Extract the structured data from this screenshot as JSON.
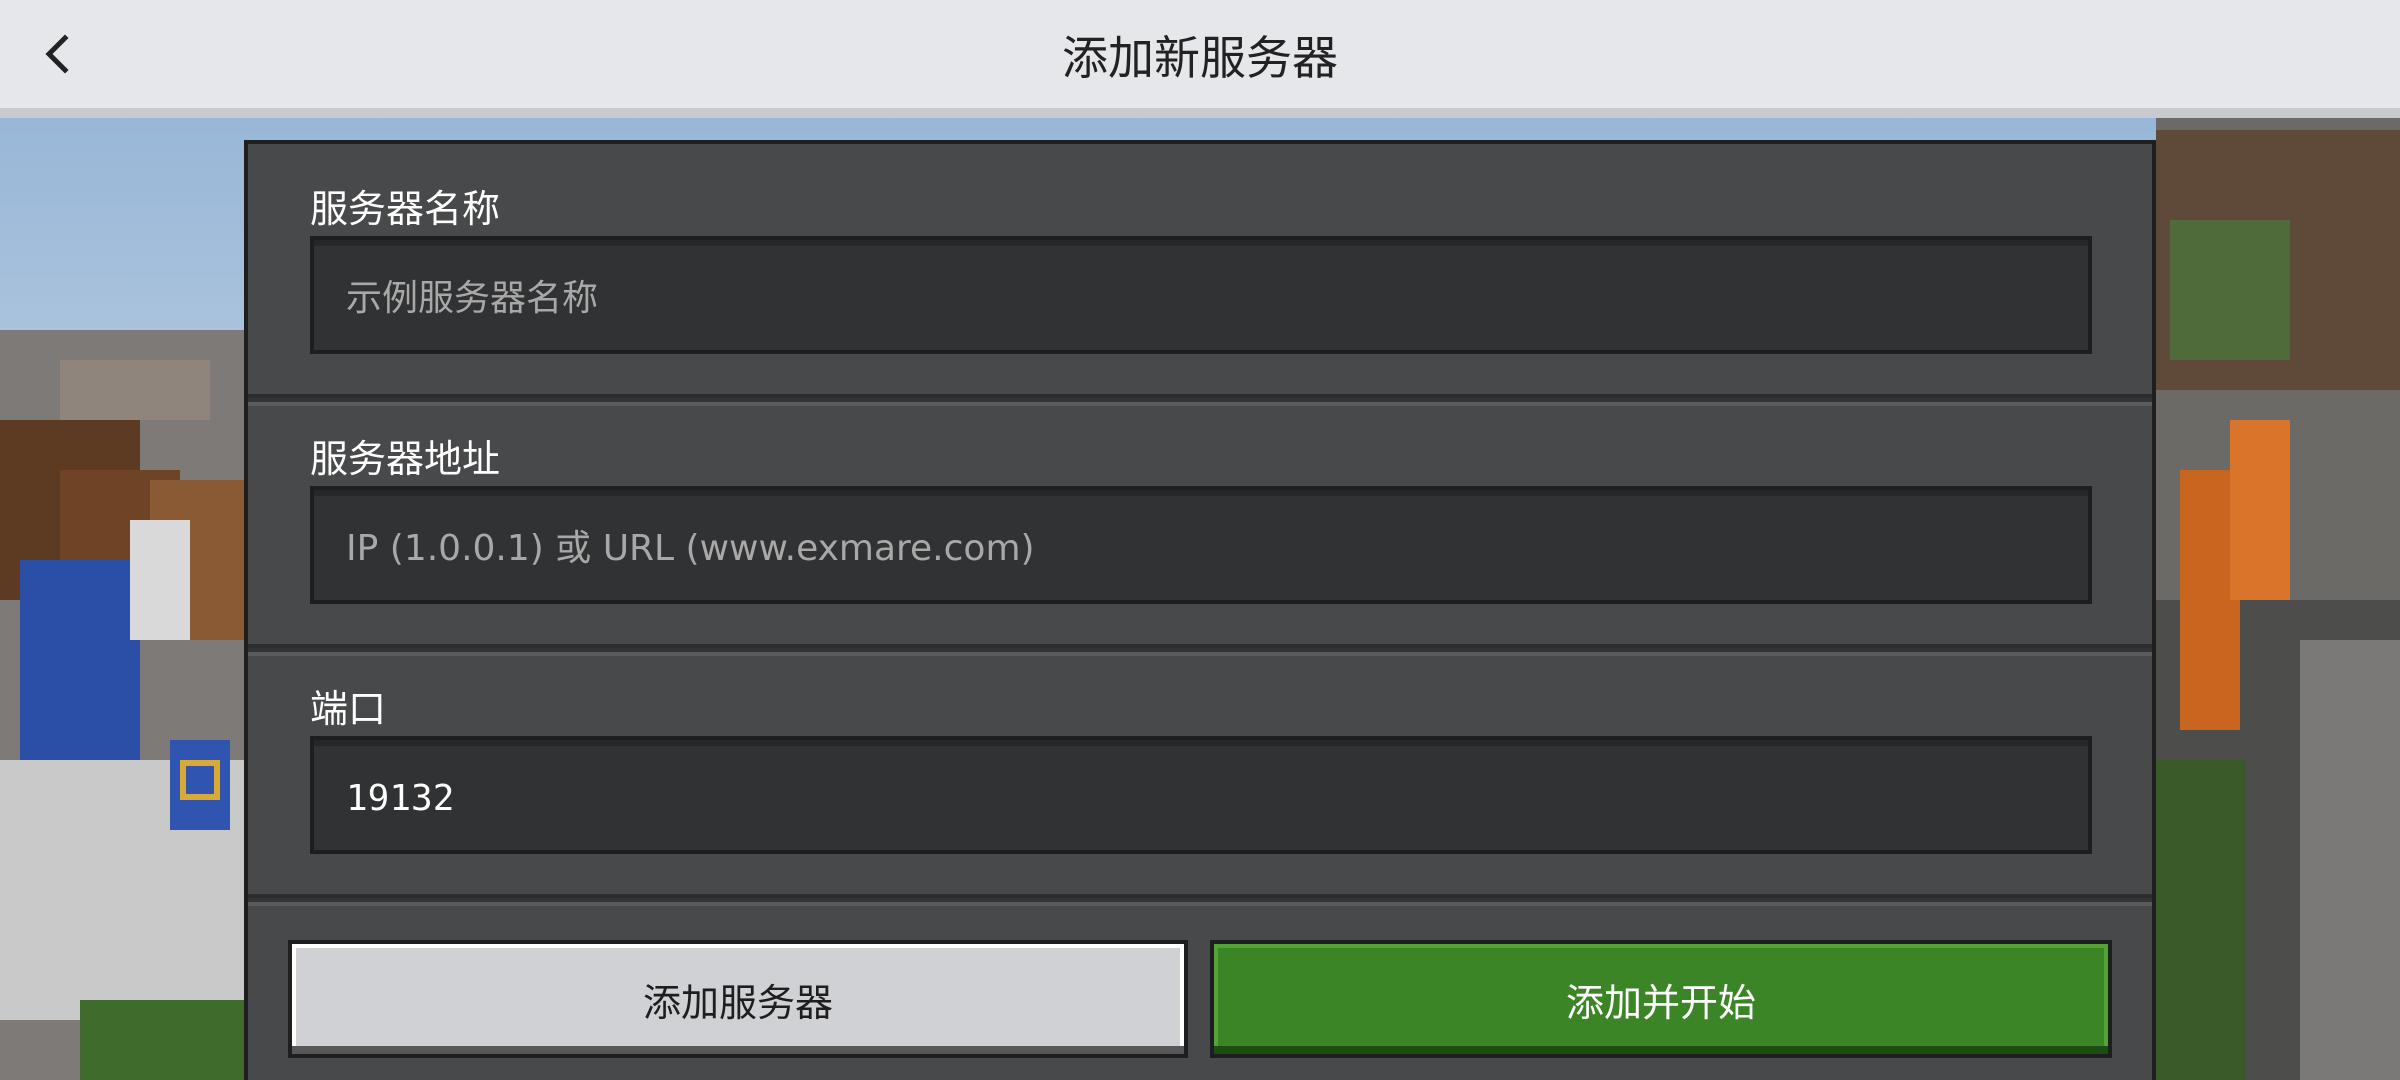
{
  "header": {
    "title": "添加新服务器",
    "back_icon": "chevron-left-icon"
  },
  "form": {
    "server_name": {
      "label": "服务器名称",
      "value": "",
      "placeholder": "示例服务器名称"
    },
    "server_address": {
      "label": "服务器地址",
      "value": "",
      "placeholder": "IP (1.0.0.1) 或 URL (www.exmare.com)"
    },
    "port": {
      "label": "端口",
      "value": "19132",
      "placeholder": ""
    }
  },
  "actions": {
    "add_server_label": "添加服务器",
    "add_and_start_label": "添加并开始"
  },
  "colors": {
    "topbar": "#e5e7eb",
    "panel": "#48494a",
    "input": "#313233",
    "secondary_button": "#d0d1d4",
    "primary_button": "#3c8527"
  }
}
